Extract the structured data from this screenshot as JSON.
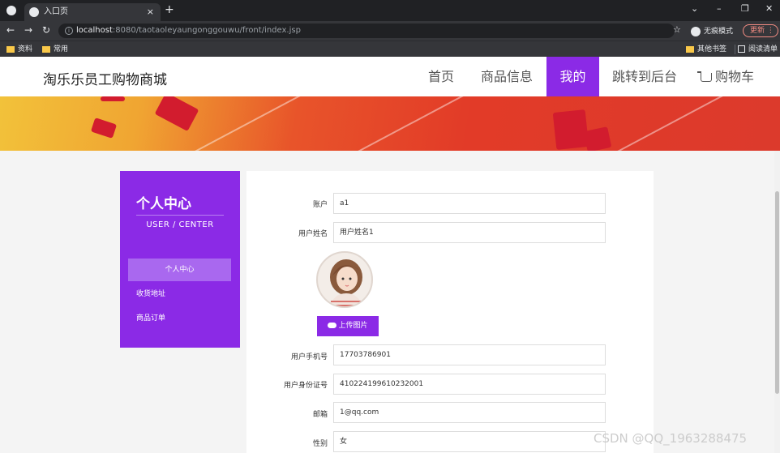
{
  "browser": {
    "tab_title": "入口页",
    "tab_close": "×",
    "new_tab": "+",
    "url_host": "localhost",
    "url_path": ":8080/taotaoleyaungonggouwu/front/index.jsp",
    "incognito_label": "无痕模式",
    "update_label": "更新",
    "bookmarks": [
      "资料",
      "常用"
    ],
    "other_bookmarks": "其他书签",
    "reading_list": "阅读清单"
  },
  "site": {
    "title": "淘乐乐员工购物商城",
    "nav": [
      "首页",
      "商品信息",
      "我的",
      "跳转到后台",
      "购物车"
    ],
    "active_nav": "我的"
  },
  "sidebar": {
    "title": "个人中心",
    "subtitle": "USER / CENTER",
    "items": [
      "个人中心",
      "收货地址",
      "商品订单"
    ]
  },
  "form": {
    "account_label": "账户",
    "account_value": "a1",
    "name_label": "用户姓名",
    "name_value": "用户姓名1",
    "upload_label": "上传图片",
    "phone_label": "用户手机号",
    "phone_value": "17703786901",
    "idcard_label": "用户身份证号",
    "idcard_value": "410224199610232001",
    "email_label": "邮箱",
    "email_value": "1@qq.com",
    "gender_label": "性别",
    "gender_value": "女"
  },
  "watermark": "CSDN @QQ_1963288475",
  "colors": {
    "accent": "#8b2ae6",
    "accent_light": "#a968ef",
    "chrome_dark": "#202124"
  }
}
